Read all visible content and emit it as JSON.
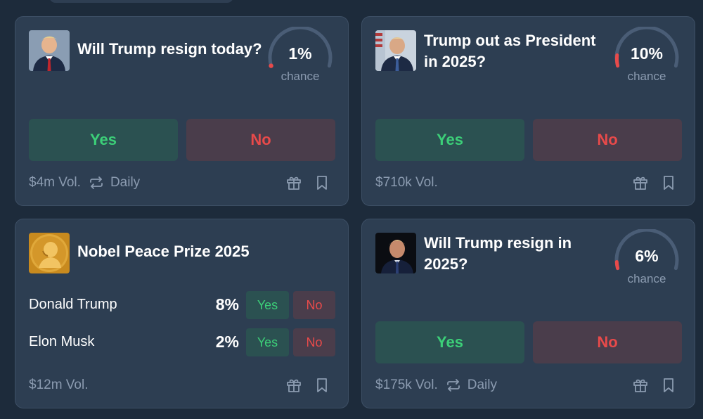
{
  "colors": {
    "background": "#1d2b3b",
    "card": "#2d3e52",
    "yes_text": "#3ccf78",
    "yes_bg": "#2b5151",
    "no_text": "#e84a4a",
    "no_bg": "#4a3d4b",
    "muted": "#8b9bb0",
    "gauge_track": "#4a5d76",
    "gauge_fill": "#e84a4a"
  },
  "markets": [
    {
      "title": "Will Trump resign today?",
      "chance_value": 1,
      "chance": "1%",
      "chance_label": "chance",
      "yes_label": "Yes",
      "no_label": "No",
      "volume": "$4m Vol.",
      "recurrence": "Daily",
      "icons": [
        "repeat-icon",
        "gift-icon",
        "bookmark-icon"
      ]
    },
    {
      "title": "Trump out as President in 2025?",
      "chance_value": 10,
      "chance": "10%",
      "chance_label": "chance",
      "yes_label": "Yes",
      "no_label": "No",
      "volume": "$710k Vol.",
      "icons": [
        "gift-icon",
        "bookmark-icon"
      ]
    },
    {
      "title": "Nobel Peace Prize 2025",
      "outcomes": [
        {
          "name": "Donald Trump",
          "pct": "8%",
          "yes_label": "Yes",
          "no_label": "No"
        },
        {
          "name": "Elon Musk",
          "pct": "2%",
          "yes_label": "Yes",
          "no_label": "No"
        }
      ],
      "volume": "$12m Vol.",
      "icons": [
        "gift-icon",
        "bookmark-icon"
      ]
    },
    {
      "title": "Will Trump resign in 2025?",
      "chance_value": 6,
      "chance": "6%",
      "chance_label": "chance",
      "yes_label": "Yes",
      "no_label": "No",
      "volume": "$175k Vol.",
      "recurrence": "Daily",
      "icons": [
        "repeat-icon",
        "gift-icon",
        "bookmark-icon"
      ]
    }
  ]
}
